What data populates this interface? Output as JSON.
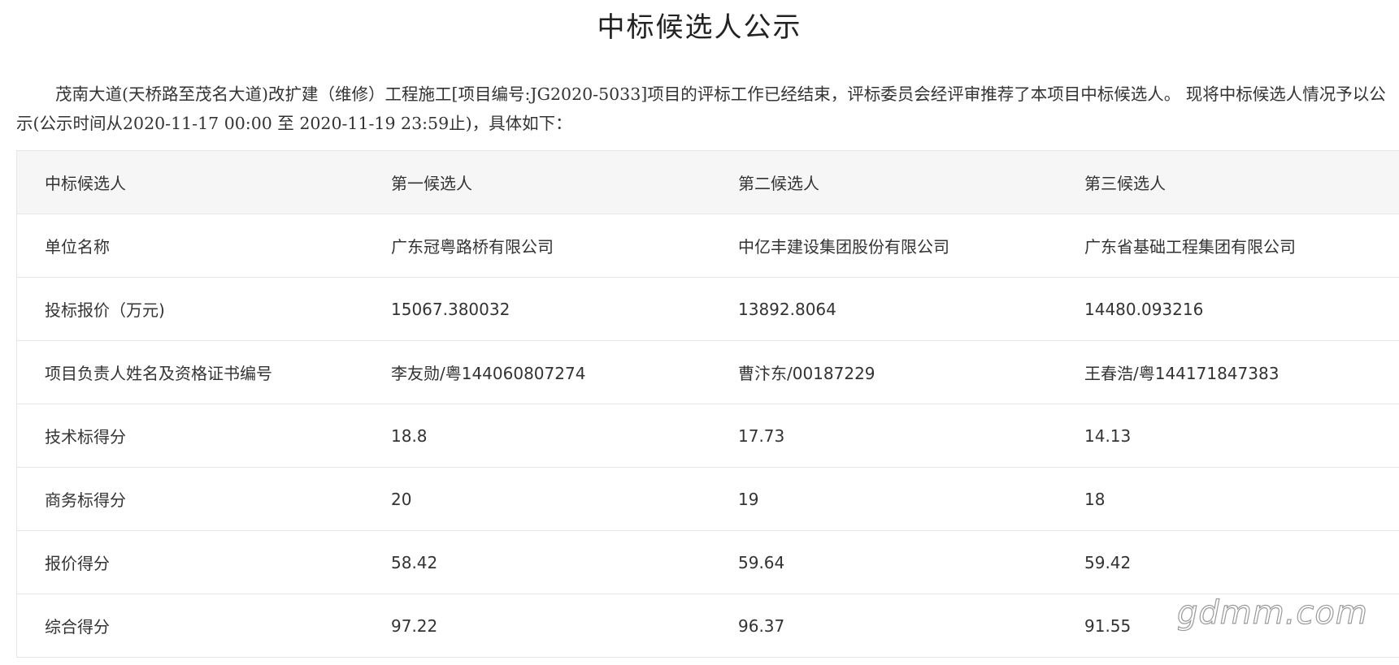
{
  "title": "中标候选人公示",
  "intro": "茂南大道(天桥路至茂名大道)改扩建（维修）工程施工[项目编号:JG2020-5033]项目的评标工作已经结束，评标委员会经评审推荐了本项目中标候选人。 现将中标候选人情况予以公示(公示时间从2020-11-17 00:00 至 2020-11-19 23:59止)，具体如下：",
  "table": {
    "header": [
      "中标候选人",
      "第一候选人",
      "第二候选人",
      "第三候选人"
    ],
    "rows": [
      [
        "单位名称",
        "广东冠粤路桥有限公司",
        "中亿丰建设集团股份有限公司",
        "广东省基础工程集团有限公司"
      ],
      [
        "投标报价（万元)",
        "15067.380032",
        "13892.8064",
        "14480.093216"
      ],
      [
        "项目负责人姓名及资格证书编号",
        "李友勋/粤144060807274",
        "曹汴东/00187229",
        "王春浩/粤144171847383"
      ],
      [
        "技术标得分",
        "18.8",
        "17.73",
        "14.13"
      ],
      [
        "商务标得分",
        "20",
        "19",
        "18"
      ],
      [
        "报价得分",
        "58.42",
        "59.64",
        "59.42"
      ],
      [
        "综合得分",
        "97.22",
        "96.37",
        "91.55"
      ]
    ]
  },
  "watermark": "gdmm.com"
}
